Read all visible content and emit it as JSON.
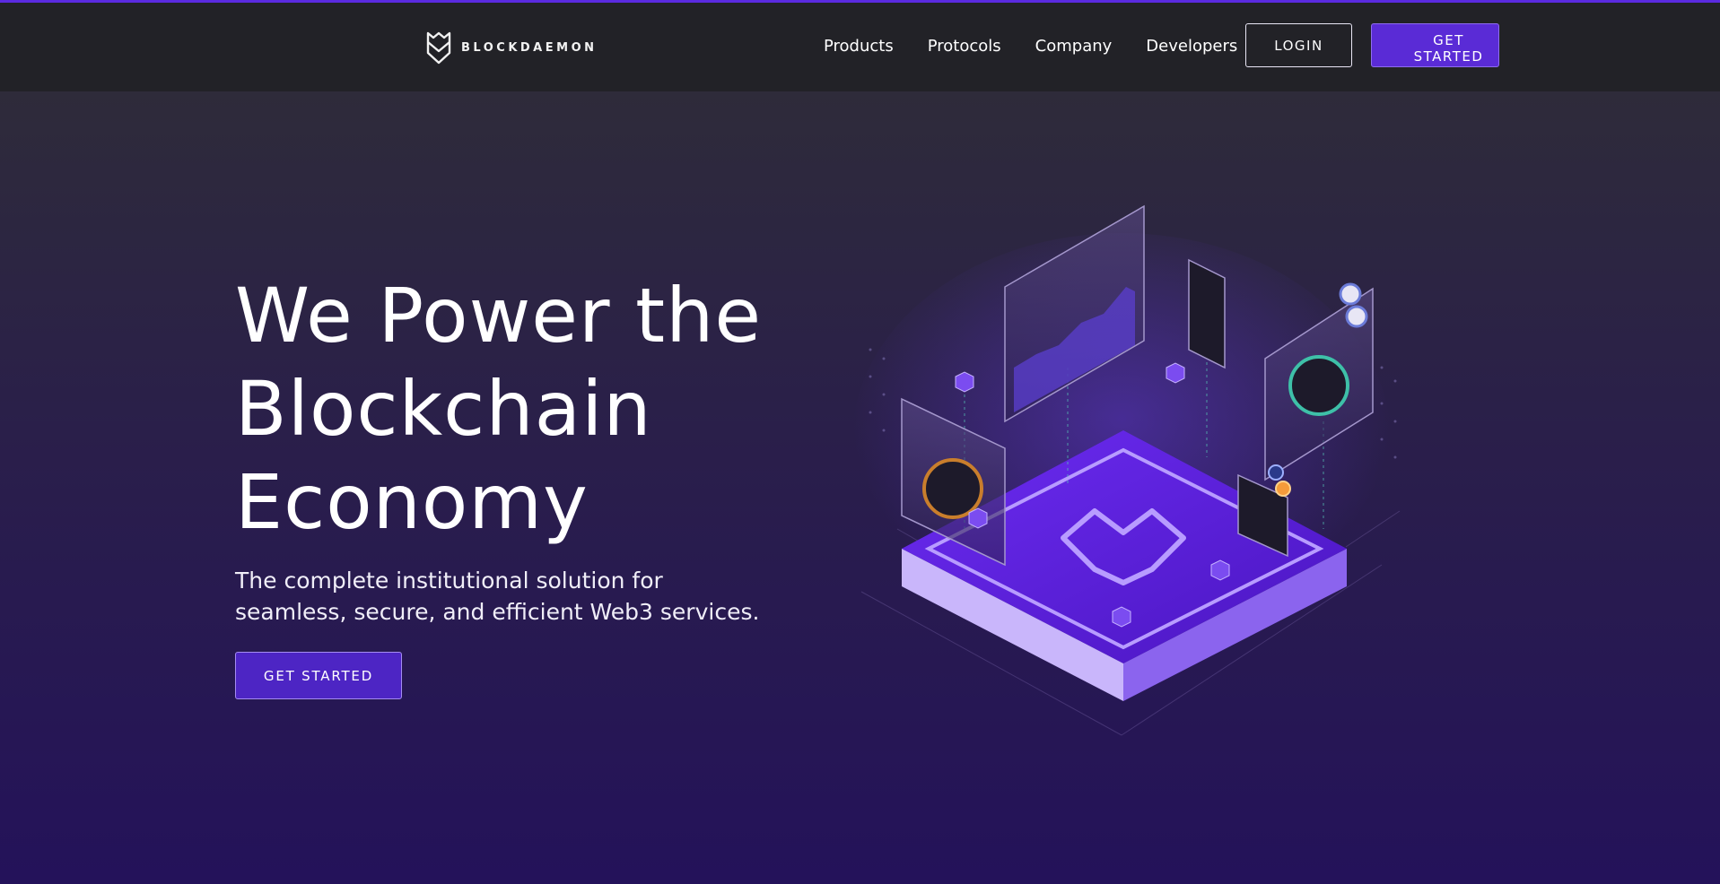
{
  "brand": {
    "name": "BLOCKDAEMON",
    "logo_icon": "blockdaemon-shield-icon",
    "accent": "#5a2bd6"
  },
  "nav": {
    "items": [
      {
        "label": "Products"
      },
      {
        "label": "Protocols"
      },
      {
        "label": "Company"
      },
      {
        "label": "Developers"
      }
    ],
    "login_label": "LOGIN",
    "get_started_line1": "GET",
    "get_started_line2": "STARTED"
  },
  "hero": {
    "title_lines": [
      "We Power the",
      "Blockchain",
      "Economy"
    ],
    "subtitle_lines": [
      "The complete institutional solution for",
      "seamless, secure, and efficient Web3 services."
    ],
    "cta_label": "GET STARTED"
  },
  "illustration": {
    "name": "isometric-blockchain-platform-illustration"
  }
}
